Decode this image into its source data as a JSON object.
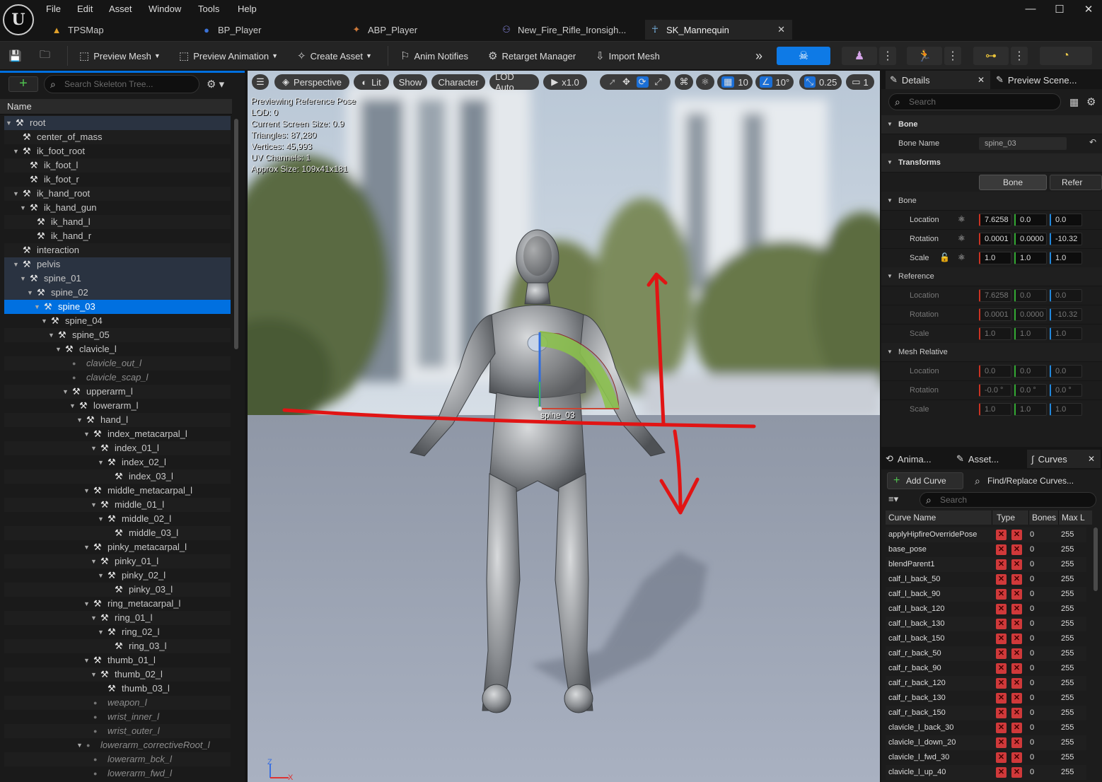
{
  "menu": [
    "File",
    "Edit",
    "Asset",
    "Window",
    "Tools",
    "Help"
  ],
  "doc_tabs": [
    {
      "label": "TPSMap",
      "icon": "map-icon",
      "active": false
    },
    {
      "label": "BP_Player",
      "icon": "blueprint-icon",
      "active": false
    },
    {
      "label": "ABP_Player",
      "icon": "anim-blueprint-icon",
      "active": false
    },
    {
      "label": "New_Fire_Rifle_Ironsigh...",
      "icon": "animation-icon",
      "active": false
    },
    {
      "label": "SK_Mannequin",
      "icon": "skeleton-icon",
      "active": true
    }
  ],
  "toolbar": {
    "preview_mesh": "Preview Mesh",
    "preview_animation": "Preview Animation",
    "create_asset": "Create Asset",
    "anim_notifies": "Anim Notifies",
    "retarget_manager": "Retarget Manager",
    "import_mesh": "Import Mesh"
  },
  "skeleton_tree": {
    "search_placeholder": "Search Skeleton Tree...",
    "column_header": "Name",
    "rows": [
      {
        "label": "root",
        "depth": 0,
        "expanded": true,
        "kind": "bone",
        "state": "hl"
      },
      {
        "label": "center_of_mass",
        "depth": 1,
        "kind": "bone"
      },
      {
        "label": "ik_foot_root",
        "depth": 1,
        "expanded": true,
        "kind": "bone"
      },
      {
        "label": "ik_foot_l",
        "depth": 2,
        "kind": "bone"
      },
      {
        "label": "ik_foot_r",
        "depth": 2,
        "kind": "bone"
      },
      {
        "label": "ik_hand_root",
        "depth": 1,
        "expanded": true,
        "kind": "bone"
      },
      {
        "label": "ik_hand_gun",
        "depth": 2,
        "expanded": true,
        "kind": "bone"
      },
      {
        "label": "ik_hand_l",
        "depth": 3,
        "kind": "bone"
      },
      {
        "label": "ik_hand_r",
        "depth": 3,
        "kind": "bone"
      },
      {
        "label": "interaction",
        "depth": 1,
        "kind": "bone"
      },
      {
        "label": "pelvis",
        "depth": 1,
        "expanded": true,
        "kind": "bone",
        "state": "hl"
      },
      {
        "label": "spine_01",
        "depth": 2,
        "expanded": true,
        "kind": "bone",
        "state": "hl"
      },
      {
        "label": "spine_02",
        "depth": 3,
        "expanded": true,
        "kind": "bone",
        "state": "hl"
      },
      {
        "label": "spine_03",
        "depth": 4,
        "expanded": true,
        "kind": "bone",
        "state": "sel"
      },
      {
        "label": "spine_04",
        "depth": 5,
        "expanded": true,
        "kind": "bone"
      },
      {
        "label": "spine_05",
        "depth": 6,
        "expanded": true,
        "kind": "bone"
      },
      {
        "label": "clavicle_l",
        "depth": 7,
        "expanded": true,
        "kind": "bone"
      },
      {
        "label": "clavicle_out_l",
        "depth": 8,
        "kind": "virtual"
      },
      {
        "label": "clavicle_scap_l",
        "depth": 8,
        "kind": "virtual"
      },
      {
        "label": "upperarm_l",
        "depth": 8,
        "expanded": true,
        "kind": "bone"
      },
      {
        "label": "lowerarm_l",
        "depth": 9,
        "expanded": true,
        "kind": "bone"
      },
      {
        "label": "hand_l",
        "depth": 10,
        "expanded": true,
        "kind": "bone"
      },
      {
        "label": "index_metacarpal_l",
        "depth": 11,
        "expanded": true,
        "kind": "bone"
      },
      {
        "label": "index_01_l",
        "depth": 12,
        "expanded": true,
        "kind": "bone"
      },
      {
        "label": "index_02_l",
        "depth": 13,
        "expanded": true,
        "kind": "bone"
      },
      {
        "label": "index_03_l",
        "depth": 14,
        "kind": "bone"
      },
      {
        "label": "middle_metacarpal_l",
        "depth": 11,
        "expanded": true,
        "kind": "bone"
      },
      {
        "label": "middle_01_l",
        "depth": 12,
        "expanded": true,
        "kind": "bone"
      },
      {
        "label": "middle_02_l",
        "depth": 13,
        "expanded": true,
        "kind": "bone"
      },
      {
        "label": "middle_03_l",
        "depth": 14,
        "kind": "bone"
      },
      {
        "label": "pinky_metacarpal_l",
        "depth": 11,
        "expanded": true,
        "kind": "bone"
      },
      {
        "label": "pinky_01_l",
        "depth": 12,
        "expanded": true,
        "kind": "bone"
      },
      {
        "label": "pinky_02_l",
        "depth": 13,
        "expanded": true,
        "kind": "bone"
      },
      {
        "label": "pinky_03_l",
        "depth": 14,
        "kind": "bone"
      },
      {
        "label": "ring_metacarpal_l",
        "depth": 11,
        "expanded": true,
        "kind": "bone"
      },
      {
        "label": "ring_01_l",
        "depth": 12,
        "expanded": true,
        "kind": "bone"
      },
      {
        "label": "ring_02_l",
        "depth": 13,
        "expanded": true,
        "kind": "bone"
      },
      {
        "label": "ring_03_l",
        "depth": 14,
        "kind": "bone"
      },
      {
        "label": "thumb_01_l",
        "depth": 11,
        "expanded": true,
        "kind": "bone"
      },
      {
        "label": "thumb_02_l",
        "depth": 12,
        "expanded": true,
        "kind": "bone"
      },
      {
        "label": "thumb_03_l",
        "depth": 13,
        "kind": "bone"
      },
      {
        "label": "weapon_l",
        "depth": 11,
        "kind": "virtual"
      },
      {
        "label": "wrist_inner_l",
        "depth": 11,
        "kind": "virtual"
      },
      {
        "label": "wrist_outer_l",
        "depth": 11,
        "kind": "virtual"
      },
      {
        "label": "lowerarm_correctiveRoot_l",
        "depth": 10,
        "expanded": true,
        "kind": "virtual"
      },
      {
        "label": "lowerarm_bck_l",
        "depth": 11,
        "kind": "virtual"
      },
      {
        "label": "lowerarm_fwd_l",
        "depth": 11,
        "kind": "virtual"
      }
    ]
  },
  "viewport": {
    "perspective": "Perspective",
    "lit": "Lit",
    "show": "Show",
    "character": "Character",
    "lod": "LOD Auto",
    "play_rate": "x1.0",
    "grid_snap": "10",
    "rot_snap": "10°",
    "scale_snap": "0.25",
    "camera_speed": "1",
    "stats": [
      "Previewing Reference Pose",
      "LOD: 0",
      "Current Screen Size: 0.9",
      "Triangles: 87,280",
      "Vertices: 45,993",
      "UV Channels: 1",
      "Approx Size: 109x41x181"
    ],
    "bone_label": "spine_03",
    "axis_z": "Z",
    "axis_x": "X"
  },
  "details": {
    "tab_details": "Details",
    "tab_preview": "Preview Scene...",
    "search_placeholder": "Search",
    "section_bone": "Bone",
    "bone_name_label": "Bone Name",
    "bone_name_value": "spine_03",
    "section_transforms": "Transforms",
    "btn_bone": "Bone",
    "btn_reference": "Refer",
    "sub_bone": "Bone",
    "sub_reference": "Reference",
    "sub_mesh_relative": "Mesh Relative",
    "lbl_location": "Location",
    "lbl_rotation": "Rotation",
    "lbl_scale": "Scale",
    "bone_location": [
      "7.6258",
      "0.0",
      "0.0"
    ],
    "bone_rotation": [
      "0.0001",
      "0.0000",
      "-10.32"
    ],
    "bone_scale": [
      "1.0",
      "1.0",
      "1.0"
    ],
    "ref_location": [
      "7.6258",
      "0.0",
      "0.0"
    ],
    "ref_rotation": [
      "0.0001",
      "0.0000",
      "-10.32"
    ],
    "ref_scale": [
      "1.0",
      "1.0",
      "1.0"
    ],
    "mesh_location": [
      "0.0",
      "0.0",
      "0.0"
    ],
    "mesh_rotation": [
      "-0.0 °",
      "0.0 °",
      "0.0 °"
    ],
    "mesh_scale": [
      "1.0",
      "1.0",
      "1.0"
    ]
  },
  "curves": {
    "tab_anim": "Anima...",
    "tab_asset": "Asset...",
    "tab_curves": "Curves",
    "add_curve": "Add Curve",
    "find_replace": "Find/Replace Curves...",
    "search_placeholder": "Search",
    "col_name": "Curve Name",
    "col_type": "Type",
    "col_bones": "Bones",
    "col_max": "Max L",
    "rows": [
      {
        "name": "applyHipfireOverridePose",
        "bones": "0",
        "max": "255"
      },
      {
        "name": "base_pose",
        "bones": "0",
        "max": "255"
      },
      {
        "name": "blendParent1",
        "bones": "0",
        "max": "255"
      },
      {
        "name": "calf_l_back_50",
        "bones": "0",
        "max": "255"
      },
      {
        "name": "calf_l_back_90",
        "bones": "0",
        "max": "255"
      },
      {
        "name": "calf_l_back_120",
        "bones": "0",
        "max": "255"
      },
      {
        "name": "calf_l_back_130",
        "bones": "0",
        "max": "255"
      },
      {
        "name": "calf_l_back_150",
        "bones": "0",
        "max": "255"
      },
      {
        "name": "calf_r_back_50",
        "bones": "0",
        "max": "255"
      },
      {
        "name": "calf_r_back_90",
        "bones": "0",
        "max": "255"
      },
      {
        "name": "calf_r_back_120",
        "bones": "0",
        "max": "255"
      },
      {
        "name": "calf_r_back_130",
        "bones": "0",
        "max": "255"
      },
      {
        "name": "calf_r_back_150",
        "bones": "0",
        "max": "255"
      },
      {
        "name": "clavicle_l_back_30",
        "bones": "0",
        "max": "255"
      },
      {
        "name": "clavicle_l_down_20",
        "bones": "0",
        "max": "255"
      },
      {
        "name": "clavicle_l_fwd_30",
        "bones": "0",
        "max": "255"
      },
      {
        "name": "clavicle_l_up_40",
        "bones": "0",
        "max": "255"
      }
    ]
  },
  "colors": {
    "selection": "#0070e0",
    "accent_blue": "#1b6fd6",
    "annotation_red": "#e11414"
  }
}
